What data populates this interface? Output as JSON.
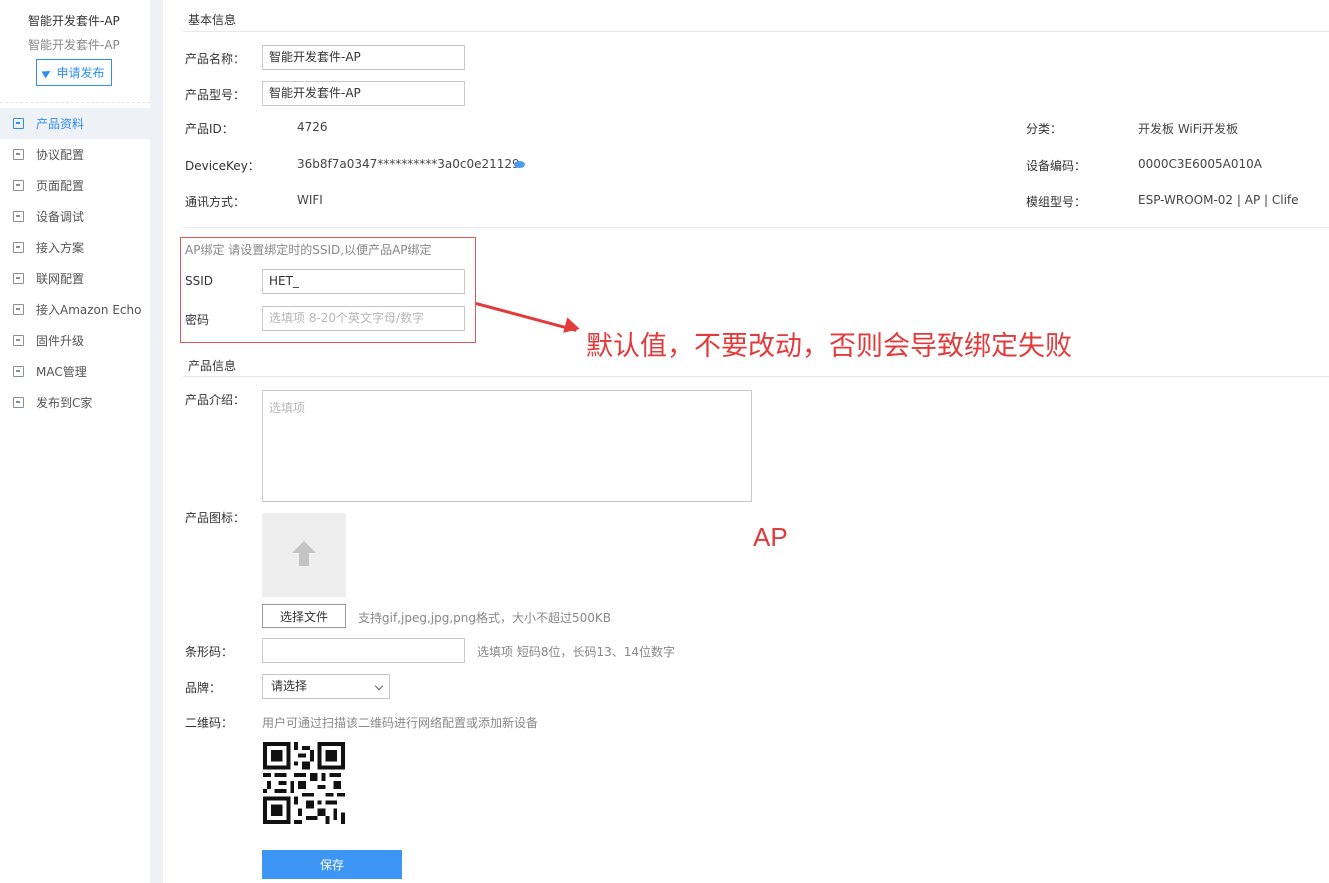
{
  "sidebar": {
    "product_name": "智能开发套件-AP",
    "product_sub": "智能开发套件-AP",
    "apply_button": "申请发布",
    "items": [
      {
        "label": "产品资料",
        "active": true
      },
      {
        "label": "协议配置"
      },
      {
        "label": "页面配置"
      },
      {
        "label": "设备调试"
      },
      {
        "label": "接入方案"
      },
      {
        "label": "联网配置"
      },
      {
        "label": "接入Amazon Echo"
      },
      {
        "label": "固件升级"
      },
      {
        "label": "MAC管理"
      },
      {
        "label": "发布到C家"
      }
    ]
  },
  "basic": {
    "section_title": "基本信息",
    "name_label": "产品名称：",
    "name_value": "智能开发套件-AP",
    "model_label": "产品型号：",
    "model_value": "智能开发套件-AP",
    "id_label": "产品ID：",
    "id_value": "4726",
    "category_label": "分类：",
    "category_value": "开发板 WiFi开发板",
    "devicekey_label": "DeviceKey：",
    "devicekey_value": "36b8f7a0347**********3a0c0e21129",
    "device_code_label": "设备编码：",
    "device_code_value": "0000C3E6005A010A",
    "comm_label": "通讯方式：",
    "comm_value": "WIFI",
    "module_label": "模组型号：",
    "module_value": "ESP-WROOM-02 | AP | Clife"
  },
  "ap": {
    "title": "AP绑定 请设置绑定时的SSID,以便产品AP绑定",
    "ssid_label": "SSID",
    "ssid_value": "HET_",
    "password_label": "密码",
    "password_placeholder": "选填项 8-20个英文字母/数字"
  },
  "annotation": {
    "text": "默认值，不要改动，否则会导致绑定失败",
    "ap_label": "AP",
    "color": "#e23b3b"
  },
  "product_info": {
    "section_title": "产品信息",
    "intro_label": "产品介绍：",
    "intro_placeholder": "选填项",
    "icon_label": "产品图标：",
    "file_button": "选择文件",
    "file_hint": "支持gif,jpeg,jpg,png格式，大小不超过500KB",
    "barcode_label": "条形码：",
    "barcode_hint": "选填项 短码8位，长码13、14位数字",
    "brand_label": "品牌：",
    "brand_selected": "请选择",
    "qr_label": "二维码：",
    "qr_hint": "用户可通过扫描该二维码进行网络配置或添加新设备",
    "save_button": "保存"
  },
  "colors": {
    "accent": "#2f8ff0",
    "save": "#3d96f5",
    "annotation": "#e23b3b"
  }
}
